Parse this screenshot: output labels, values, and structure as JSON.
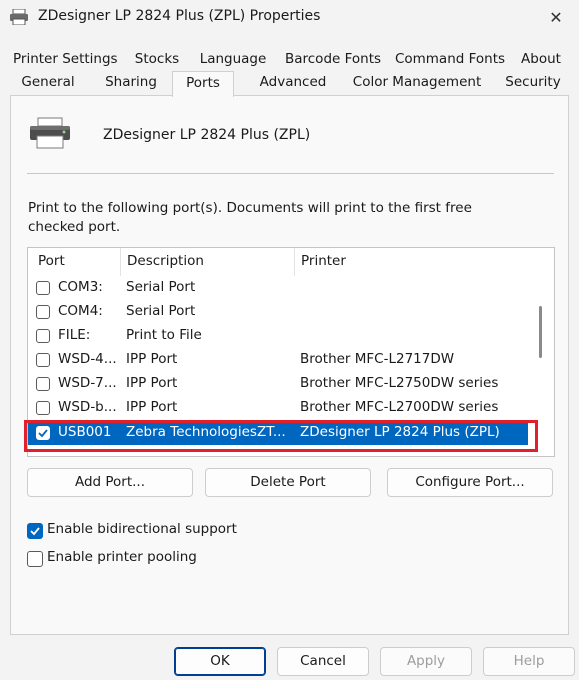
{
  "window": {
    "title": "ZDesigner LP 2824 Plus (ZPL) Properties",
    "close_glyph": "✕"
  },
  "tabs": {
    "row1": [
      "Printer Settings",
      "Stocks",
      "Language",
      "Barcode Fonts",
      "Command Fonts",
      "About"
    ],
    "row2": [
      "General",
      "Sharing",
      "Ports",
      "Advanced",
      "Color Management",
      "Security"
    ],
    "active": "Ports"
  },
  "panel": {
    "printer_name": "ZDesigner LP 2824 Plus (ZPL)",
    "instructions": "Print to the following port(s). Documents will print to the first free checked port.",
    "columns": [
      "Port",
      "Description",
      "Printer"
    ],
    "ports": [
      {
        "port": "COM3:",
        "description": "Serial Port",
        "printer": "",
        "checked": false,
        "selected": false
      },
      {
        "port": "COM4:",
        "description": "Serial Port",
        "printer": "",
        "checked": false,
        "selected": false
      },
      {
        "port": "FILE:",
        "description": "Print to File",
        "printer": "",
        "checked": false,
        "selected": false
      },
      {
        "port": "WSD-4...",
        "description": "IPP Port",
        "printer": "Brother MFC-L2717DW",
        "checked": false,
        "selected": false
      },
      {
        "port": "WSD-7...",
        "description": "IPP Port",
        "printer": "Brother MFC-L2750DW series",
        "checked": false,
        "selected": false
      },
      {
        "port": "WSD-b...",
        "description": "IPP Port",
        "printer": "Brother MFC-L2700DW series",
        "checked": false,
        "selected": false
      },
      {
        "port": "USB001",
        "description": "Zebra TechnologiesZT...",
        "printer": "ZDesigner LP 2824 Plus (ZPL)",
        "checked": true,
        "selected": true
      }
    ],
    "buttons": {
      "add_port": "Add Port...",
      "delete_port": "Delete Port",
      "configure_port": "Configure Port..."
    },
    "options": {
      "bidirectional": {
        "label": "Enable bidirectional support",
        "checked": true
      },
      "pooling": {
        "label": "Enable printer pooling",
        "checked": false
      }
    }
  },
  "footer": {
    "ok": "OK",
    "cancel": "Cancel",
    "apply": "Apply",
    "help": "Help"
  },
  "colors": {
    "accent": "#0067c0",
    "highlight_border": "#e0202a"
  }
}
